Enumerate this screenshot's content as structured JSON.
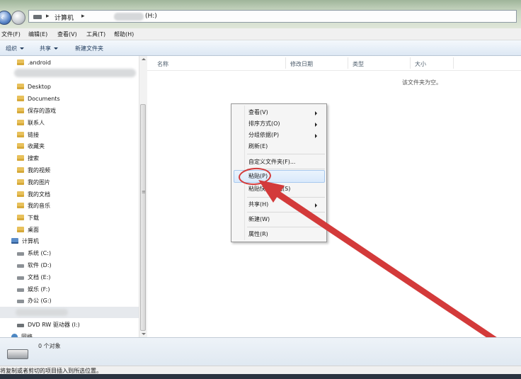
{
  "address": {
    "crumbs": [
      "计算机",
      "(H:)"
    ]
  },
  "menu": [
    "文件(F)",
    "编辑(E)",
    "查看(V)",
    "工具(T)",
    "帮助(H)"
  ],
  "toolbar": {
    "organize": "组织",
    "share": "共享",
    "new_folder": "新建文件夹"
  },
  "nav": {
    "items": [
      {
        "label": ".android",
        "icon": "folder-icon"
      },
      {
        "label": "Desktop",
        "icon": "folder-icon"
      },
      {
        "label": "Documents",
        "icon": "folder-icon"
      },
      {
        "label": "保存的游戏",
        "icon": "folder-icon"
      },
      {
        "label": "联系人",
        "icon": "folder-icon"
      },
      {
        "label": "链接",
        "icon": "folder-icon"
      },
      {
        "label": "收藏夹",
        "icon": "folder-icon"
      },
      {
        "label": "搜索",
        "icon": "folder-icon"
      },
      {
        "label": "我的视频",
        "icon": "folder-icon"
      },
      {
        "label": "我的图片",
        "icon": "folder-icon"
      },
      {
        "label": "我的文档",
        "icon": "folder-icon"
      },
      {
        "label": "我的音乐",
        "icon": "folder-icon"
      },
      {
        "label": "下载",
        "icon": "folder-icon"
      },
      {
        "label": "桌面",
        "icon": "folder-icon"
      }
    ],
    "computer": "计算机",
    "drives": [
      {
        "label": "系统 (C:)"
      },
      {
        "label": "软件 (D:)"
      },
      {
        "label": "文档 (E:)"
      },
      {
        "label": "娱乐 (F:)"
      },
      {
        "label": "办公 (G:)"
      }
    ],
    "dvd": "DVD RW 驱动器 (I:)",
    "network": "网络"
  },
  "columns": [
    "名称",
    "修改日期",
    "类型",
    "大小"
  ],
  "empty_text": "该文件夹为空。",
  "context_menu": {
    "view": "查看(V)",
    "sort": "排序方式(O)",
    "group": "分组依据(P)",
    "refresh": "刷新(E)",
    "customize": "自定义文件夹(F)...",
    "paste": "粘贴(P)",
    "paste_shortcut": "粘贴快捷方式(S)",
    "share": "共享(H)",
    "new": "新建(W)",
    "properties": "属性(R)"
  },
  "details": {
    "count": "0 个对象"
  },
  "status": "将复制或者剪切的项目插入到所选位置。",
  "colors": {
    "annotation": "#d33a3a",
    "highlight": "#d9e9fb"
  }
}
